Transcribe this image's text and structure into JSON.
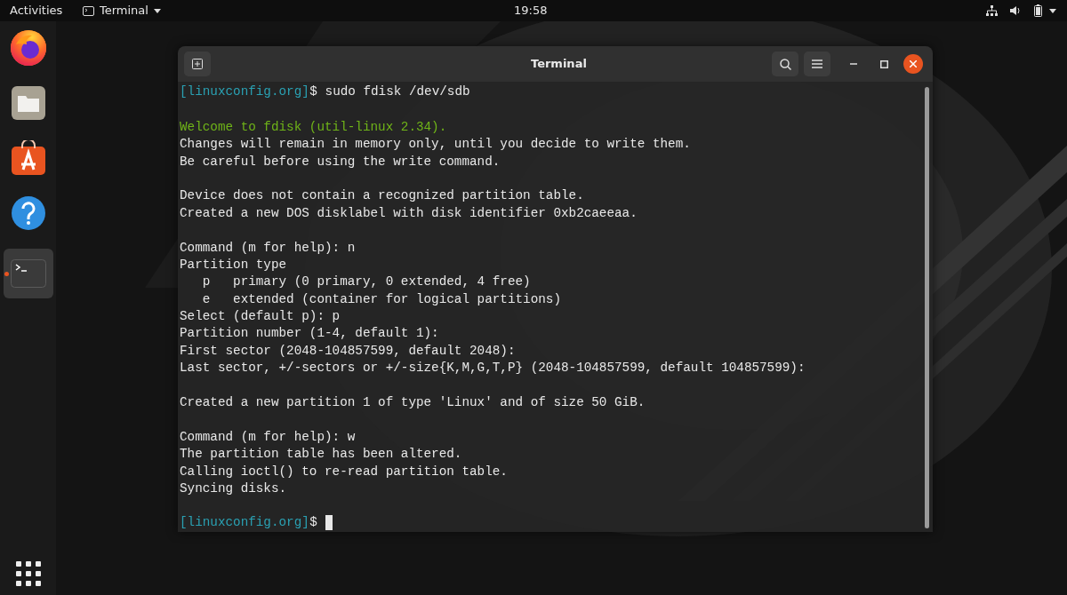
{
  "top_bar": {
    "activities": "Activities",
    "app_menu": "Terminal",
    "clock": "19:58"
  },
  "dock": {
    "items": [
      {
        "kind": "firefox",
        "running": false
      },
      {
        "kind": "files",
        "running": false
      },
      {
        "kind": "software",
        "running": false
      },
      {
        "kind": "help",
        "running": false
      },
      {
        "kind": "terminal",
        "running": true
      }
    ]
  },
  "window": {
    "title": "Terminal"
  },
  "terminal": {
    "lines": [
      {
        "kind": "prompt",
        "prompt": "[linuxconfig.org]",
        "symbol": "$",
        "command": "sudo fdisk /dev/sdb"
      },
      {
        "kind": "blank"
      },
      {
        "kind": "highlight",
        "text": "Welcome to fdisk (util-linux 2.34)."
      },
      {
        "kind": "plain",
        "text": "Changes will remain in memory only, until you decide to write them."
      },
      {
        "kind": "plain",
        "text": "Be careful before using the write command."
      },
      {
        "kind": "blank"
      },
      {
        "kind": "plain",
        "text": "Device does not contain a recognized partition table."
      },
      {
        "kind": "plain",
        "text": "Created a new DOS disklabel with disk identifier 0xb2caeeaa."
      },
      {
        "kind": "blank"
      },
      {
        "kind": "plain",
        "text": "Command (m for help): n"
      },
      {
        "kind": "plain",
        "text": "Partition type"
      },
      {
        "kind": "plain",
        "text": "   p   primary (0 primary, 0 extended, 4 free)"
      },
      {
        "kind": "plain",
        "text": "   e   extended (container for logical partitions)"
      },
      {
        "kind": "plain",
        "text": "Select (default p): p"
      },
      {
        "kind": "plain",
        "text": "Partition number (1-4, default 1):"
      },
      {
        "kind": "plain",
        "text": "First sector (2048-104857599, default 2048):"
      },
      {
        "kind": "plain",
        "text": "Last sector, +/-sectors or +/-size{K,M,G,T,P} (2048-104857599, default 104857599):"
      },
      {
        "kind": "blank"
      },
      {
        "kind": "plain",
        "text": "Created a new partition 1 of type 'Linux' and of size 50 GiB."
      },
      {
        "kind": "blank"
      },
      {
        "kind": "plain",
        "text": "Command (m for help): w"
      },
      {
        "kind": "plain",
        "text": "The partition table has been altered."
      },
      {
        "kind": "plain",
        "text": "Calling ioctl() to re-read partition table."
      },
      {
        "kind": "plain",
        "text": "Syncing disks."
      },
      {
        "kind": "blank"
      },
      {
        "kind": "prompt_cursor",
        "prompt": "[linuxconfig.org]",
        "symbol": "$"
      }
    ]
  }
}
